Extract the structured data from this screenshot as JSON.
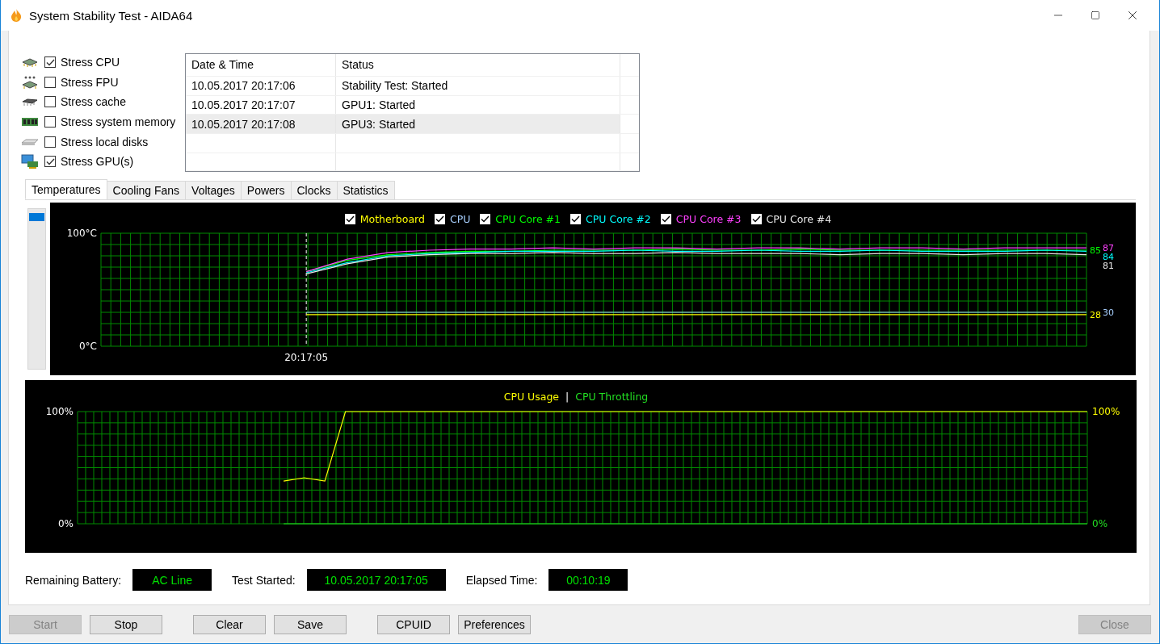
{
  "window": {
    "title": "System Stability Test - AIDA64"
  },
  "stress_options": [
    {
      "label": "Stress CPU",
      "checked": true,
      "kind": "cpu"
    },
    {
      "label": "Stress FPU",
      "checked": false,
      "kind": "fpu"
    },
    {
      "label": "Stress cache",
      "checked": false,
      "kind": "cache"
    },
    {
      "label": "Stress system memory",
      "checked": false,
      "kind": "memory"
    },
    {
      "label": "Stress local disks",
      "checked": false,
      "kind": "disk"
    },
    {
      "label": "Stress GPU(s)",
      "checked": true,
      "kind": "gpu"
    }
  ],
  "event_log": {
    "columns": [
      "Date & Time",
      "Status"
    ],
    "rows": [
      {
        "time": "10.05.2017 20:17:06",
        "status": "Stability Test: Started",
        "selected": false
      },
      {
        "time": "10.05.2017 20:17:07",
        "status": "GPU1: Started",
        "selected": false
      },
      {
        "time": "10.05.2017 20:17:08",
        "status": "GPU3: Started",
        "selected": true
      }
    ]
  },
  "tabs": [
    {
      "label": "Temperatures",
      "selected": true
    },
    {
      "label": "Cooling Fans",
      "selected": false
    },
    {
      "label": "Voltages",
      "selected": false
    },
    {
      "label": "Powers",
      "selected": false
    },
    {
      "label": "Clocks",
      "selected": false
    },
    {
      "label": "Statistics",
      "selected": false
    }
  ],
  "temperature_chart": {
    "legend_checkboxes": [
      {
        "checked": true
      },
      {
        "checked": true
      },
      {
        "checked": true
      },
      {
        "checked": true
      },
      {
        "checked": true
      },
      {
        "checked": true
      }
    ],
    "start_time": "20:17:05",
    "end_readings": [
      {
        "text": "85",
        "color": "#00ff00"
      },
      {
        "text": "87",
        "color": "#ff40ff"
      },
      {
        "text": "84",
        "color": "#00ffff"
      },
      {
        "text": "81",
        "color": "#e8e8e8"
      },
      {
        "text": "28",
        "color": "#ffff00"
      },
      {
        "text": "30",
        "color": "#a8d0ff"
      }
    ],
    "chart_data": {
      "type": "line",
      "grid": true,
      "ylim": [
        0,
        100
      ],
      "yticks": [
        {
          "value": 0,
          "label": "0°C"
        },
        {
          "value": 100,
          "label": "100°C"
        }
      ],
      "series": [
        {
          "name": "Motherboard",
          "color": "#ffff00",
          "values": [
            null,
            null,
            null,
            null,
            null,
            28,
            28,
            28,
            28,
            28,
            28,
            28,
            28,
            28,
            28,
            28,
            28,
            28,
            28,
            28,
            28,
            28,
            28,
            28,
            28
          ]
        },
        {
          "name": "CPU",
          "color": "#a8d0ff",
          "values": [
            null,
            null,
            null,
            null,
            null,
            30,
            30,
            30,
            30,
            30,
            30,
            30,
            30,
            30,
            30,
            30,
            30,
            30,
            30,
            30,
            30,
            30,
            30,
            30,
            30
          ]
        },
        {
          "name": "CPU Core #1",
          "color": "#00ff00",
          "values": [
            null,
            null,
            null,
            null,
            null,
            66,
            76,
            81,
            83,
            84,
            84,
            85,
            85,
            85,
            86,
            85,
            85,
            86,
            85,
            85,
            85,
            85,
            85,
            85,
            85
          ]
        },
        {
          "name": "CPU Core #2",
          "color": "#00ffff",
          "values": [
            null,
            null,
            null,
            null,
            null,
            65,
            74,
            80,
            82,
            83,
            84,
            84,
            84,
            85,
            84,
            84,
            85,
            84,
            84,
            85,
            84,
            84,
            84,
            85,
            84
          ]
        },
        {
          "name": "CPU Core #3",
          "color": "#ff40ff",
          "values": [
            null,
            null,
            null,
            null,
            null,
            66,
            77,
            83,
            85,
            86,
            86,
            87,
            86,
            87,
            87,
            86,
            87,
            87,
            86,
            87,
            87,
            86,
            87,
            87,
            87
          ]
        },
        {
          "name": "CPU Core #4",
          "color": "#e8e8e8",
          "values": [
            null,
            null,
            null,
            null,
            null,
            64,
            73,
            79,
            81,
            82,
            82,
            83,
            82,
            82,
            83,
            82,
            82,
            82,
            81,
            82,
            82,
            81,
            82,
            82,
            81
          ]
        }
      ]
    }
  },
  "usage_chart": {
    "legend_separator": "|",
    "right_labels": [
      "100%",
      "0%"
    ],
    "chart_data": {
      "type": "line",
      "grid": true,
      "ylim": [
        0,
        100
      ],
      "yticks": [
        {
          "value": 0,
          "label": "0%"
        },
        {
          "value": 100,
          "label": "100%"
        }
      ],
      "series": [
        {
          "name": "CPU Usage",
          "color": "#ffff00",
          "values": [
            null,
            null,
            null,
            null,
            null,
            null,
            null,
            null,
            null,
            null,
            38,
            41,
            38,
            100,
            100,
            100,
            100,
            100,
            100,
            100,
            100,
            100,
            100,
            100,
            100,
            100,
            100,
            100,
            100,
            100,
            100,
            100,
            100,
            100,
            100,
            100,
            100,
            100,
            100,
            100,
            100,
            100,
            100,
            100,
            100,
            100,
            100,
            100,
            100,
            100
          ]
        },
        {
          "name": "CPU Throttling",
          "color": "#22dd22",
          "values": [
            null,
            null,
            null,
            null,
            null,
            null,
            null,
            null,
            null,
            null,
            0,
            0,
            0,
            0,
            0,
            0,
            0,
            0,
            0,
            0,
            0,
            0,
            0,
            0,
            0,
            0,
            0,
            0,
            0,
            0,
            0,
            0,
            0,
            0,
            0,
            0,
            0,
            0,
            0,
            0,
            0,
            0,
            0,
            0,
            0,
            0,
            0,
            0,
            0,
            0
          ]
        }
      ]
    }
  },
  "status": [
    {
      "label": "Remaining Battery:",
      "value": "AC Line"
    },
    {
      "label": "Test Started:",
      "value": "10.05.2017 20:17:05"
    },
    {
      "label": "Elapsed Time:",
      "value": "00:10:19"
    }
  ],
  "button_groups": [
    [
      {
        "label": "Start",
        "disabled": true
      },
      {
        "label": "Stop",
        "disabled": false
      }
    ],
    [
      {
        "label": "Clear",
        "disabled": false
      },
      {
        "label": "Save",
        "disabled": false
      }
    ],
    [
      {
        "label": "CPUID",
        "disabled": false
      },
      {
        "label": "Preferences",
        "disabled": false
      }
    ],
    [
      {
        "label": "Close",
        "disabled": true
      }
    ]
  ]
}
